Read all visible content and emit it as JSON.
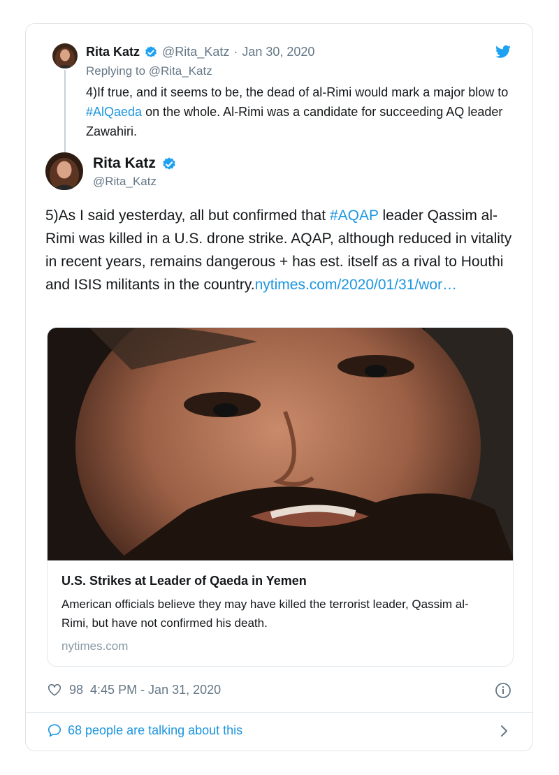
{
  "parent_tweet": {
    "name": "Rita Katz",
    "handle": "@Rita_Katz",
    "separator": "·",
    "date": "Jan 30, 2020",
    "replying_to": "Replying to @Rita_Katz",
    "text_before": "4)If true, and it seems to be, the dead of al-Rimi would mark a major blow to ",
    "hashtag": "#AlQaeda",
    "text_after": " on the whole. Al-Rimi was a candidate for succeeding AQ leader Zawahiri."
  },
  "main_tweet": {
    "name": "Rita Katz",
    "handle": "@Rita_Katz",
    "text_before": "5)As I said yesterday, all but confirmed that ",
    "hashtag": "#AQAP",
    "text_after": " leader Qassim al-Rimi was killed in a U.S. drone strike. AQAP, although reduced in vitality in recent years, remains dangerous + has est. itself as a rival to Houthi and ISIS militants in the country.",
    "link": "nytimes.com/2020/01/31/wor…"
  },
  "link_card": {
    "title": "U.S. Strikes at Leader of Qaeda in Yemen",
    "description": "American officials believe they may have killed the terrorist leader, Qassim al-Rimi, but have not confirmed his death.",
    "domain": "nytimes.com"
  },
  "meta": {
    "likes": "98",
    "timestamp": "4:45 PM - Jan 31, 2020"
  },
  "footer": {
    "talking": "68 people are talking about this"
  },
  "icons": {
    "verified": "verified-badge-icon",
    "twitter": "twitter-bird-icon",
    "like": "heart-icon",
    "info": "info-icon",
    "reply": "speech-bubble-icon",
    "chevron": "chevron-right-icon"
  },
  "colors": {
    "link": "#1b95e0",
    "secondary": "#657786",
    "border": "#e1e8ed"
  }
}
